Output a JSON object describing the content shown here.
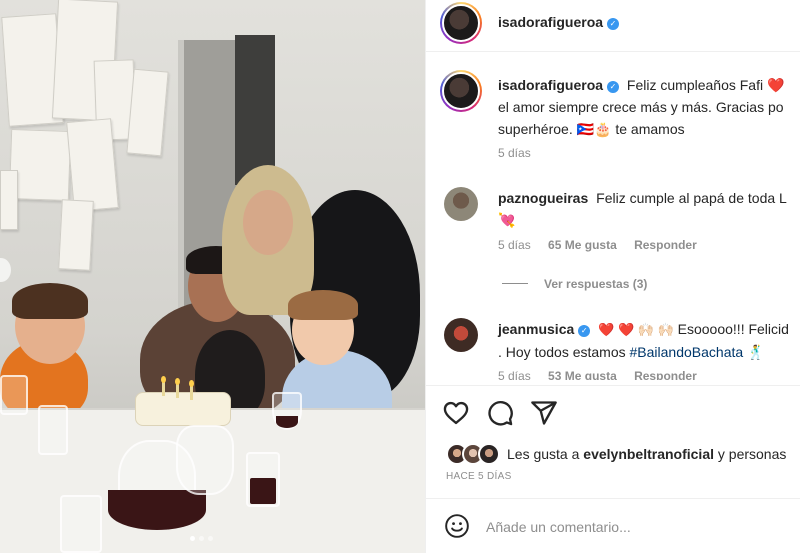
{
  "post": {
    "author": "isadorafigueroa",
    "verified": true
  },
  "caption": {
    "username": "isadorafigueroa",
    "line1": "Feliz cumpleaños Fafi ❤️ ",
    "line2": "el amor siempre crece más y más. Gracias po",
    "line3": "superhéroe. 🇵🇷🎂 te amamos",
    "time": "5 días"
  },
  "comments": [
    {
      "username": "paznogueiras",
      "line1": "Feliz cumple al papá de toda L",
      "line2": "💘",
      "time": "5 días",
      "likes": "65 Me gusta",
      "reply": "Responder",
      "view_replies": "Ver respuestas (3)"
    },
    {
      "username": "jeanmusica",
      "verified": true,
      "line1_text": "Esooooo!!! Felicid",
      "line1_emoji": "❤️ ❤️ 🙌🏻 🙌🏻",
      "line2_pre": ". Hoy todos estamos ",
      "line2_tag": "#BailandoBachata",
      "line2_emoji": "🕺",
      "time": "5 días",
      "likes": "53 Me gusta",
      "reply": "Responder"
    }
  ],
  "actions": {
    "like_icon": "heart-icon",
    "comment_icon": "comment-icon",
    "share_icon": "share-icon"
  },
  "likes": {
    "prefix": "Les gusta a ",
    "user": "evelynbeltranoficial",
    "suffix": " y personas"
  },
  "timestamp": "HACE 5 DÍAS",
  "add_comment": {
    "placeholder": "Añade un comentario...",
    "emoji_icon": "smiley-icon"
  },
  "colors": {
    "text": "#262626",
    "muted": "#8e8e8e",
    "verified": "#3897f0",
    "hashtag": "#00376b",
    "heart": "#ed4956"
  }
}
